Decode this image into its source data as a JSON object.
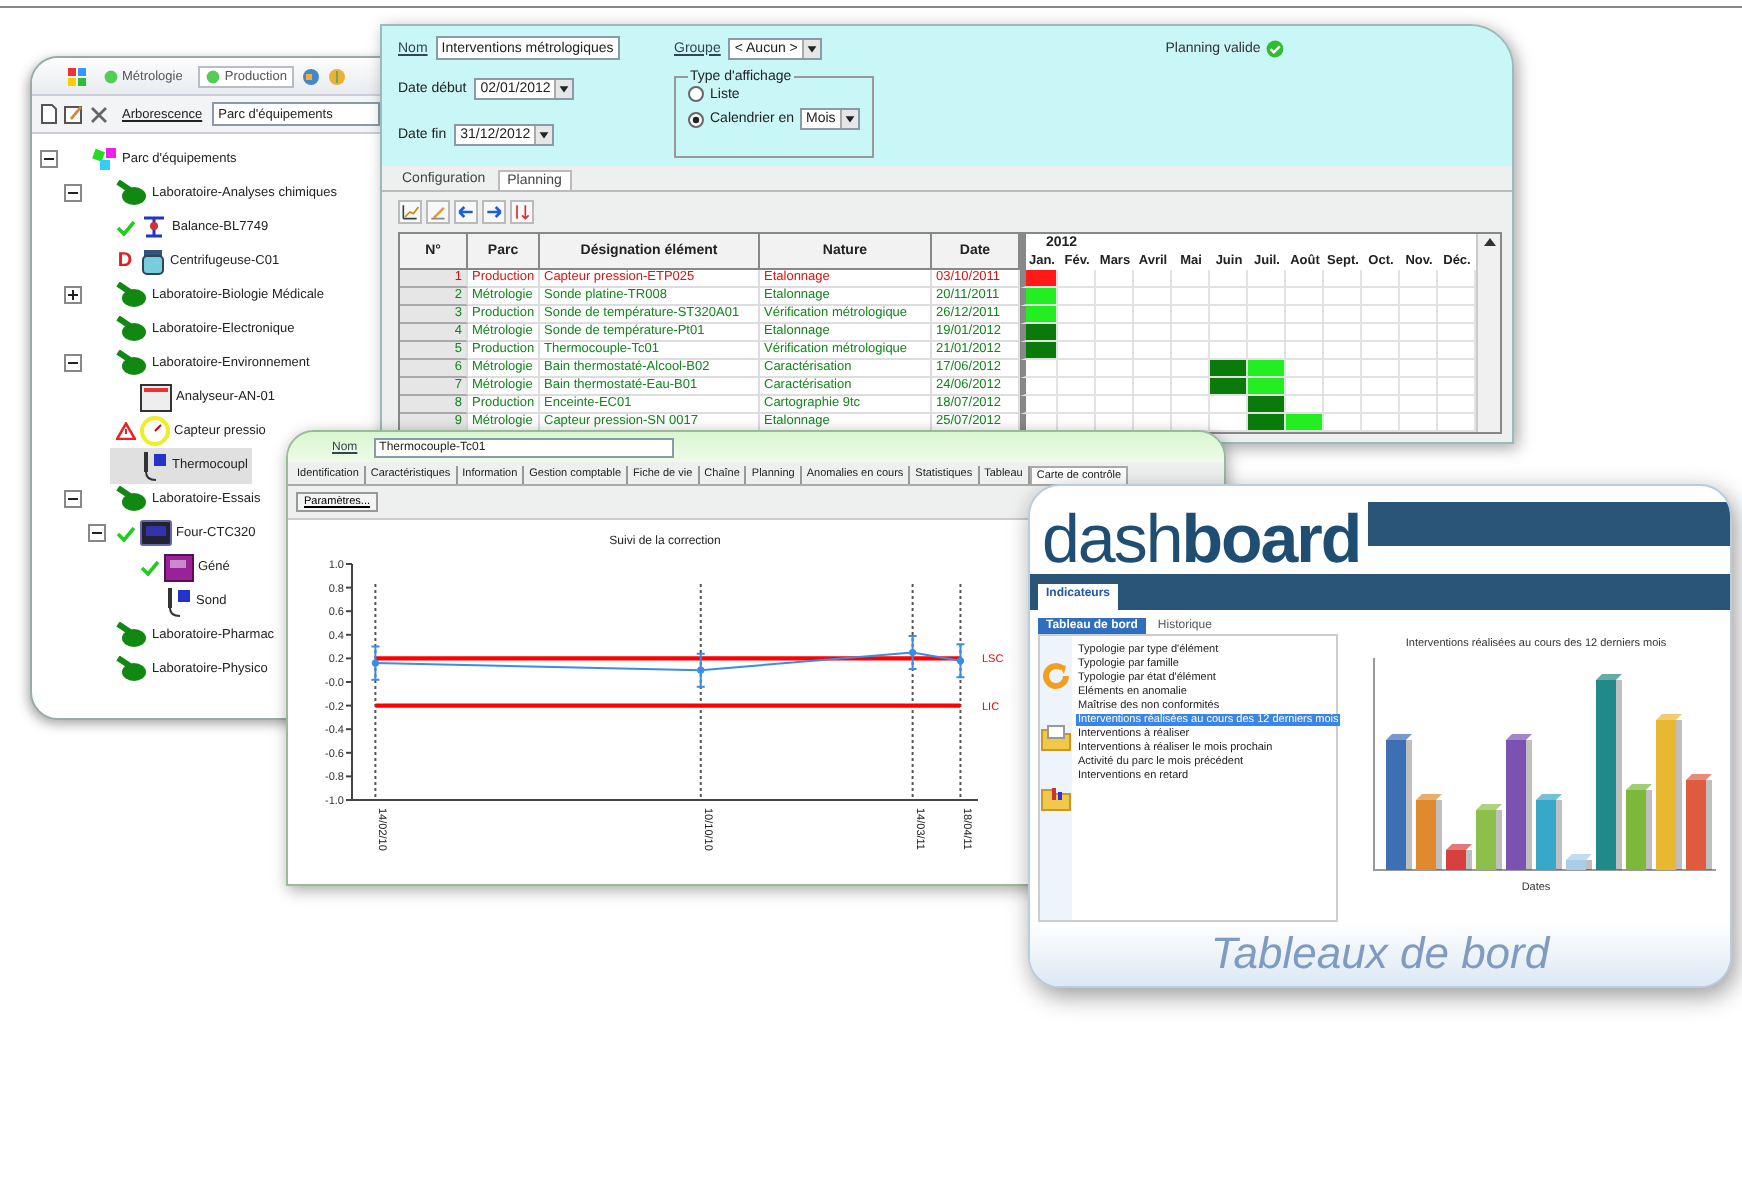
{
  "tree_window": {
    "toolbar_tabs": [
      {
        "label": "Métrologie",
        "selected": false
      },
      {
        "label": "Production",
        "selected": true
      }
    ],
    "path_label": "Arborescence",
    "path_value": "Parc d'équipements",
    "tree": [
      {
        "label": "Parc d'équipements",
        "kind": "park",
        "expanded": true,
        "selected": false,
        "children": [
          {
            "label": "Laboratoire-Analyses chimiques",
            "kind": "lab",
            "expanded": true,
            "selected": false,
            "children": [
              {
                "label": "Balance-BL7749",
                "kind": "balance",
                "validated": true,
                "alert": false,
                "selected": false
              },
              {
                "label": "Centrifugeuse-C01",
                "kind": "centrifuge",
                "validated": false,
                "alert": false,
                "badge": "D",
                "selected": false
              }
            ]
          },
          {
            "label": "Laboratoire-Biologie Médicale",
            "kind": "lab",
            "expanded": false,
            "selected": false
          },
          {
            "label": "Laboratoire-Electronique",
            "kind": "lab",
            "selected": false
          },
          {
            "label": "Laboratoire-Environnement",
            "kind": "lab",
            "expanded": true,
            "selected": false,
            "children": [
              {
                "label": "Analyseur-AN-01",
                "kind": "analyzer",
                "validated": false,
                "alert": false,
                "selected": false
              },
              {
                "label": "Capteur pressio",
                "kind": "gauge",
                "validated": false,
                "alert": true,
                "selected": false
              },
              {
                "label": "Thermocoupl",
                "kind": "probe",
                "validated": false,
                "alert": false,
                "selected": true
              }
            ]
          },
          {
            "label": "Laboratoire-Essais",
            "kind": "lab",
            "expanded": true,
            "selected": false,
            "children": [
              {
                "label": "Four-CTC320",
                "kind": "oven",
                "validated": true,
                "alert": false,
                "expanded": true,
                "selected": false,
                "children": [
                  {
                    "label": "Géné",
                    "kind": "generator",
                    "validated": true,
                    "alert": false,
                    "selected": false
                  },
                  {
                    "label": "Sond",
                    "kind": "probe",
                    "validated": false,
                    "alert": false,
                    "selected": false
                  }
                ]
              }
            ]
          },
          {
            "label": "Laboratoire-Pharmac",
            "kind": "lab",
            "selected": false
          },
          {
            "label": "Laboratoire-Physico",
            "kind": "lab",
            "selected": false
          }
        ]
      }
    ]
  },
  "planning_window": {
    "name_label": "Nom",
    "name_value": "Interventions métrologiques",
    "group_label": "Groupe",
    "group_value": "< Aucun >",
    "status": "Planning valide",
    "start_label": "Date début",
    "start_value": "02/01/2012",
    "end_label": "Date fin",
    "end_value": "31/12/2012",
    "display_group": "Type d'affichage",
    "display_options": [
      {
        "label": "Liste",
        "selected": false
      },
      {
        "label": "Calendrier en",
        "selected": true
      }
    ],
    "period_value": "Mois",
    "tabs": [
      {
        "label": "Configuration",
        "selected": false
      },
      {
        "label": "Planning",
        "selected": true
      }
    ],
    "columns": [
      "N°",
      "Parc",
      "Désignation élément",
      "Nature",
      "Date"
    ],
    "year": "2012",
    "months": [
      "Jan.",
      "Fév.",
      "Mars",
      "Avril",
      "Mai",
      "Juin",
      "Juil.",
      "Août",
      "Sept.",
      "Oct.",
      "Nov.",
      "Déc."
    ],
    "rows": [
      {
        "number": "1",
        "park": "Production",
        "element": "Capteur pression-ETP025",
        "nature": "Etalonnage",
        "date": "03/10/2011",
        "late": true,
        "cells": [
          {
            "filled": true,
            "color": "#ff1a1a"
          },
          {
            "filled": false
          },
          {
            "filled": false
          },
          {
            "filled": false
          },
          {
            "filled": false
          },
          {
            "filled": false
          },
          {
            "filled": false
          },
          {
            "filled": false
          },
          {
            "filled": false
          },
          {
            "filled": false
          },
          {
            "filled": false
          },
          {
            "filled": false
          }
        ]
      },
      {
        "number": "2",
        "park": "Métrologie",
        "element": "Sonde platine-TR008",
        "nature": "Etalonnage",
        "date": "20/11/2011",
        "late": false,
        "cells": [
          {
            "filled": true,
            "color": "#22ee22"
          },
          {
            "filled": false
          },
          {
            "filled": false
          },
          {
            "filled": false
          },
          {
            "filled": false
          },
          {
            "filled": false
          },
          {
            "filled": false
          },
          {
            "filled": false
          },
          {
            "filled": false
          },
          {
            "filled": false
          },
          {
            "filled": false
          },
          {
            "filled": false
          }
        ]
      },
      {
        "number": "3",
        "park": "Production",
        "element": "Sonde de température-ST320A01",
        "nature": "Vérification métrologique",
        "date": "26/12/2011",
        "late": false,
        "cells": [
          {
            "filled": true,
            "color": "#22ee22"
          },
          {
            "filled": false
          },
          {
            "filled": false
          },
          {
            "filled": false
          },
          {
            "filled": false
          },
          {
            "filled": false
          },
          {
            "filled": false
          },
          {
            "filled": false
          },
          {
            "filled": false
          },
          {
            "filled": false
          },
          {
            "filled": false
          },
          {
            "filled": false
          }
        ]
      },
      {
        "number": "4",
        "park": "Métrologie",
        "element": "Sonde de température-Pt01",
        "nature": "Etalonnage",
        "date": "19/01/2012",
        "late": false,
        "cells": [
          {
            "filled": true,
            "color": "#0a7a0a"
          },
          {
            "filled": false
          },
          {
            "filled": false
          },
          {
            "filled": false
          },
          {
            "filled": false
          },
          {
            "filled": false
          },
          {
            "filled": false
          },
          {
            "filled": false
          },
          {
            "filled": false
          },
          {
            "filled": false
          },
          {
            "filled": false
          },
          {
            "filled": false
          }
        ]
      },
      {
        "number": "5",
        "park": "Production",
        "element": "Thermocouple-Tc01",
        "nature": "Vérification métrologique",
        "date": "21/01/2012",
        "late": false,
        "cells": [
          {
            "filled": true,
            "color": "#0a7a0a"
          },
          {
            "filled": false
          },
          {
            "filled": false
          },
          {
            "filled": false
          },
          {
            "filled": false
          },
          {
            "filled": false
          },
          {
            "filled": false
          },
          {
            "filled": false
          },
          {
            "filled": false
          },
          {
            "filled": false
          },
          {
            "filled": false
          },
          {
            "filled": false
          }
        ]
      },
      {
        "number": "6",
        "park": "Métrologie",
        "element": "Bain thermostaté-Alcool-B02",
        "nature": "Caractérisation",
        "date": "17/06/2012",
        "late": false,
        "cells": [
          {
            "filled": false
          },
          {
            "filled": false
          },
          {
            "filled": false
          },
          {
            "filled": false
          },
          {
            "filled": false
          },
          {
            "filled": true,
            "color": "#0a7a0a"
          },
          {
            "filled": true,
            "color": "#22ee22"
          },
          {
            "filled": false
          },
          {
            "filled": false
          },
          {
            "filled": false
          },
          {
            "filled": false
          },
          {
            "filled": false
          }
        ]
      },
      {
        "number": "7",
        "park": "Métrologie",
        "element": "Bain thermostaté-Eau-B01",
        "nature": "Caractérisation",
        "date": "24/06/2012",
        "late": false,
        "cells": [
          {
            "filled": false
          },
          {
            "filled": false
          },
          {
            "filled": false
          },
          {
            "filled": false
          },
          {
            "filled": false
          },
          {
            "filled": true,
            "color": "#0a7a0a"
          },
          {
            "filled": true,
            "color": "#22ee22"
          },
          {
            "filled": false
          },
          {
            "filled": false
          },
          {
            "filled": false
          },
          {
            "filled": false
          },
          {
            "filled": false
          }
        ]
      },
      {
        "number": "8",
        "park": "Production",
        "element": "Enceinte-EC01",
        "nature": "Cartographie 9tc",
        "date": "18/07/2012",
        "late": false,
        "cells": [
          {
            "filled": false
          },
          {
            "filled": false
          },
          {
            "filled": false
          },
          {
            "filled": false
          },
          {
            "filled": false
          },
          {
            "filled": false
          },
          {
            "filled": true,
            "color": "#0a7a0a"
          },
          {
            "filled": false
          },
          {
            "filled": false
          },
          {
            "filled": false
          },
          {
            "filled": false
          },
          {
            "filled": false
          }
        ]
      },
      {
        "number": "9",
        "park": "Métrologie",
        "element": "Capteur pression-SN 0017",
        "nature": "Etalonnage",
        "date": "25/07/2012",
        "late": false,
        "cells": [
          {
            "filled": false
          },
          {
            "filled": false
          },
          {
            "filled": false
          },
          {
            "filled": false
          },
          {
            "filled": false
          },
          {
            "filled": false
          },
          {
            "filled": true,
            "color": "#0a7a0a"
          },
          {
            "filled": true,
            "color": "#22ee22"
          },
          {
            "filled": false
          },
          {
            "filled": false
          },
          {
            "filled": false
          },
          {
            "filled": false
          }
        ]
      }
    ]
  },
  "chart_window": {
    "name_label": "Nom",
    "name_value": "Thermocouple-Tc01",
    "tabs": [
      {
        "label": "Identification",
        "selected": false
      },
      {
        "label": "Caractéristiques",
        "selected": false
      },
      {
        "label": "Information",
        "selected": false
      },
      {
        "label": "Gestion comptable",
        "selected": false
      },
      {
        "label": "Fiche de vie",
        "selected": false
      },
      {
        "label": "Chaîne",
        "selected": false
      },
      {
        "label": "Planning",
        "selected": false
      },
      {
        "label": "Anomalies en cours",
        "selected": false
      },
      {
        "label": "Statistiques",
        "selected": false
      },
      {
        "label": "Tableau",
        "selected": false
      },
      {
        "label": "Carte de contrôle",
        "selected": true
      }
    ],
    "parameters_button": "Paramètres...",
    "chart_data": {
      "type": "line",
      "title": "Suivi de la correction",
      "x": [
        "14/02/10",
        "10/10/10",
        "14/03/11",
        "18/04/11"
      ],
      "series": [
        {
          "color": "#3c8ce6",
          "marker": "circle",
          "values": [
            0.16,
            0.1,
            0.25,
            0.18
          ],
          "errors": [
            0.14,
            0.14,
            0.14,
            0.14
          ]
        },
        {
          "name": "LSC",
          "color": "#ff0000",
          "values": [
            0.2,
            0.2,
            0.2,
            0.2
          ]
        },
        {
          "name": "LIC",
          "color": "#ff0000",
          "values": [
            -0.2,
            -0.2,
            -0.2,
            -0.2
          ]
        }
      ],
      "grid": true,
      "ylim": [
        -1,
        1
      ],
      "yticks": [
        {
          "value": 1,
          "label": "1.0"
        },
        {
          "value": 0.8,
          "label": "0.8"
        },
        {
          "value": 0.6,
          "label": "0.6"
        },
        {
          "value": 0.4,
          "label": "0.4"
        },
        {
          "value": 0.2,
          "label": "0.2"
        },
        {
          "value": 0,
          "label": "-0.0"
        },
        {
          "value": -0.2,
          "label": "-0.2"
        },
        {
          "value": -0.4,
          "label": "-0.4"
        },
        {
          "value": -0.6,
          "label": "-0.6"
        },
        {
          "value": -0.8,
          "label": "-0.8"
        },
        {
          "value": -1,
          "label": "-1.0"
        }
      ]
    }
  },
  "dashboard_window": {
    "logo": "dash**board**",
    "top_tab": "Indicateurs",
    "tabs": [
      {
        "label": "Tableau de bord",
        "selected": true
      },
      {
        "label": "Historique",
        "selected": false
      }
    ],
    "indicators": [
      {
        "label": "Typologie par type d'élément",
        "selected": false
      },
      {
        "label": "Typologie par famille",
        "selected": false
      },
      {
        "label": "Typologie par état d'élément",
        "selected": false
      },
      {
        "label": "Eléments en anomalie",
        "selected": false
      },
      {
        "label": "Maîtrise des non conformités",
        "selected": false
      },
      {
        "label": "Interventions réalisées au cours des 12 derniers mois",
        "selected": true
      },
      {
        "label": "Interventions à réaliser",
        "selected": false
      },
      {
        "label": "Interventions à réaliser le mois prochain",
        "selected": false
      },
      {
        "label": "Activité du parc le mois précédent",
        "selected": false
      },
      {
        "label": "Interventions en retard",
        "selected": false
      }
    ],
    "chart_title": "Interventions réalisées au cours des 12 derniers mois",
    "chart_xlabel": "Dates",
    "footer": "Tableaux de bord"
  }
}
